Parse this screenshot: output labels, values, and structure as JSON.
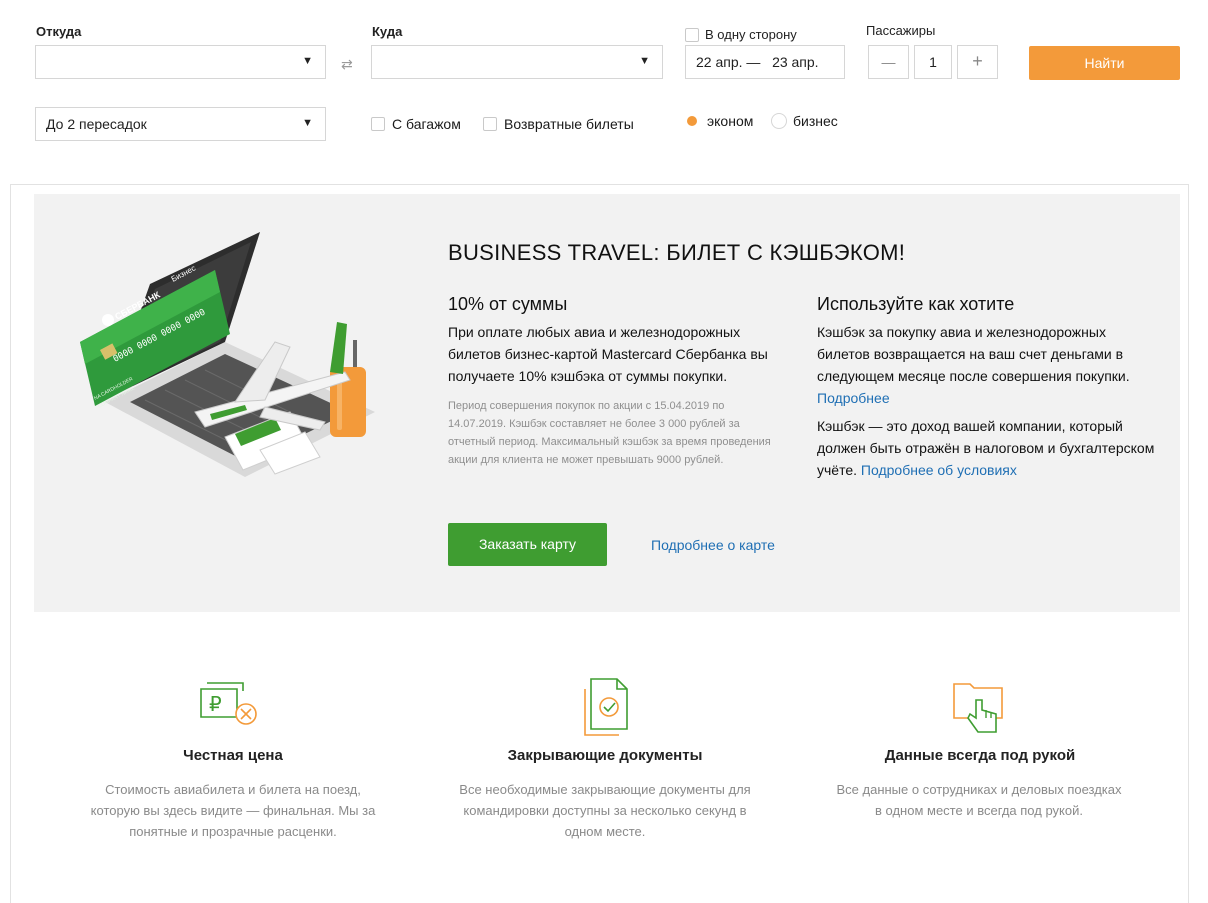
{
  "search": {
    "from_label": "Откуда",
    "from_value": "",
    "to_label": "Куда",
    "to_value": "",
    "swap_glyph": "⇄",
    "one_way_label": "В одну сторону",
    "dates_value": "22 апр. —   23 апр.",
    "passengers_label": "Пассажиры",
    "minus_glyph": "—",
    "passengers_value": "1",
    "plus_glyph": "+",
    "find_label": "Найти",
    "transfers_value": "До 2 пересадок",
    "baggage_label": "С багажом",
    "return_label": "Возвратные билеты",
    "econom_label": "эконом",
    "business_label": "бизнес",
    "selected_class": "эконом"
  },
  "promo": {
    "title": "BUSINESS TRAVEL: БИЛЕТ С КЭШБЭКОМ!",
    "left_heading": "10% от суммы",
    "left_text": "При оплате любых авиа и железнодорожных билетов бизнес-картой Mastercard Сбербанка вы получаете 10% кэшбэка от суммы покупки.",
    "left_small": "Период совершения покупок по акции с 15.04.2019 по 14.07.2019. Кэшбэк составляет не более 3 000 рублей за отчетный период. Максимальный кэшбэк за время проведения акции для клиента не может превышать 9000 рублей.",
    "right_heading": "Используйте как хотите",
    "right_text1": "Кэшбэк за покупку авиа и железнодорожных билетов возвращается на ваш счет деньгами в следующем месяце после совершения покупки.",
    "right_link1": "Подробнее",
    "right_text2": "Кэшбэк — это доход вашей компании, который должен быть отражён в налоговом и бухгалтерском учёте.",
    "right_link2": "Подробнее об условиях",
    "order_button": "Заказать карту",
    "card_link": "Подробнее о карте",
    "card_bank": "СБЕРБАНК",
    "card_tier": "Бизнес",
    "card_number": "0000 0000 0000 0000",
    "card_holder": "NA CARDHOLDER",
    "card_company": "COMPANY NAME"
  },
  "features": [
    {
      "icon": "ruble-price-icon",
      "title": "Честная цена",
      "text": "Стоимость авиабилета и билета на поезд, которую вы здесь видите — финальная. Мы за понятные и прозрачные расценки."
    },
    {
      "icon": "document-check-icon",
      "title": "Закрывающие документы",
      "text": "Все необходимые закрывающие документы для командировки доступны за несколько секунд в одном месте."
    },
    {
      "icon": "folder-hand-icon",
      "title": "Данные всегда под рукой",
      "text": "Все данные о сотрудниках и деловых поездках в одном месте и всегда под рукой."
    }
  ],
  "colors": {
    "accent_orange": "#f39a3a",
    "accent_green": "#3f9d31",
    "link_blue": "#1f6fb4",
    "hero_bg": "#f2f2f2"
  }
}
